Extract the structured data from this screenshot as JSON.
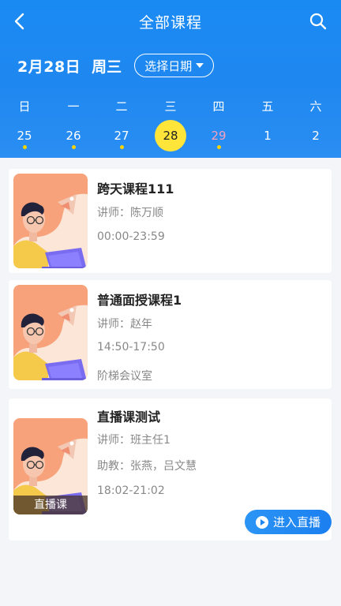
{
  "header": {
    "title": "全部课程",
    "date": "2月28日",
    "weekday": "周三",
    "pick_date_label": "选择日期"
  },
  "week": {
    "labels": [
      "日",
      "一",
      "二",
      "三",
      "四",
      "五",
      "六"
    ],
    "days": [
      "25",
      "26",
      "27",
      "28",
      "29",
      "1",
      "2"
    ]
  },
  "courses": [
    {
      "title": "跨天课程111",
      "teacher": "讲师：陈万顺",
      "time": "00:00-23:59"
    },
    {
      "title": "普通面授课程1",
      "teacher": "讲师：赵年",
      "time": "14:50-17:50",
      "location": "阶梯会议室"
    },
    {
      "title": "直播课测试",
      "teacher": "讲师：班主任1",
      "assistant": "助教：张燕，吕文慧",
      "time": "18:02-21:02",
      "tag": "直播课",
      "action": "进入直播"
    }
  ],
  "colors": {
    "primary": "#1f88f0",
    "selected_day": "#ffe43a",
    "dot": "#f5d400"
  }
}
